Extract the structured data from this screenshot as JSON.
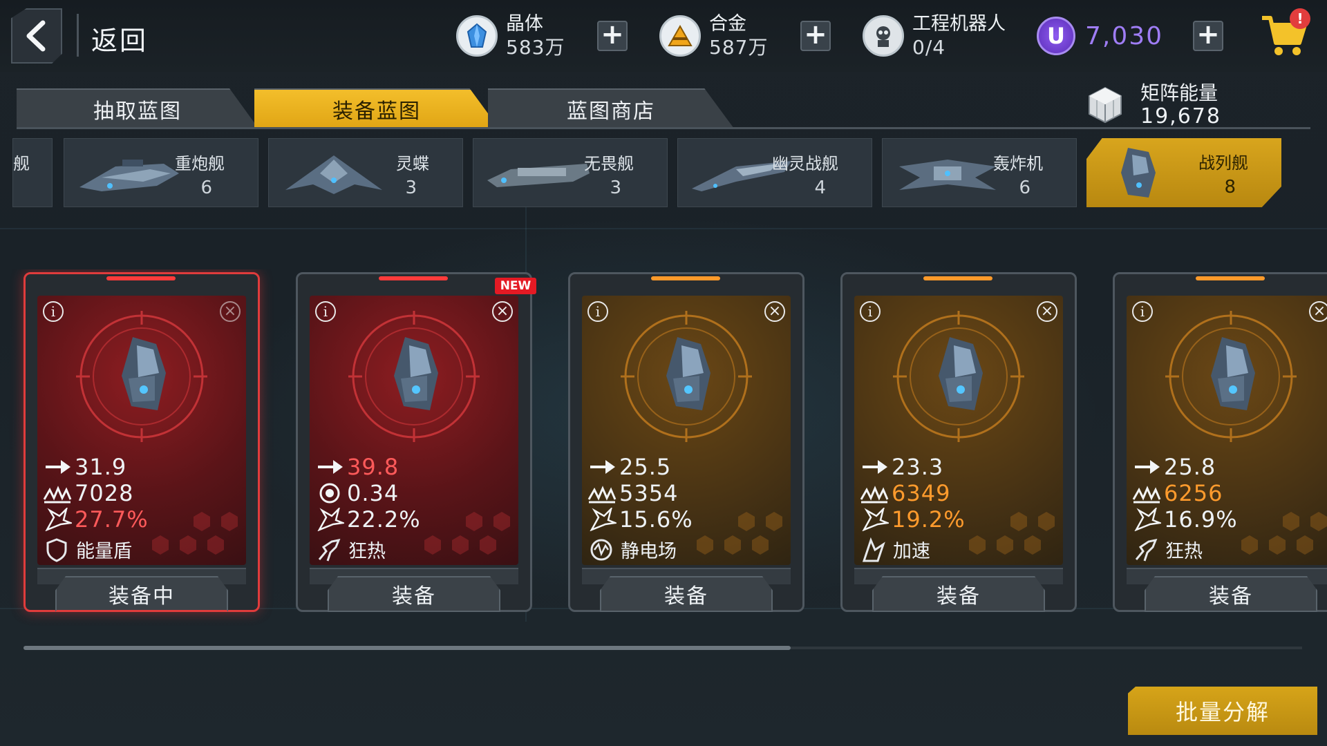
{
  "header": {
    "back_label": "返回",
    "resources": [
      {
        "name": "晶体",
        "value": "583万",
        "icon": "crystal-icon"
      },
      {
        "name": "合金",
        "value": "587万",
        "icon": "alloy-icon"
      },
      {
        "name": "工程机器人",
        "value": "0/4",
        "icon": "robot-icon"
      }
    ],
    "currency": {
      "symbol": "U",
      "value": "7,030",
      "color": "#9f7df5"
    },
    "cart_badge": "!"
  },
  "tabs": [
    {
      "label": "抽取蓝图",
      "active": false
    },
    {
      "label": "装备蓝图",
      "active": true
    },
    {
      "label": "蓝图商店",
      "active": false
    }
  ],
  "matrix_energy": {
    "label": "矩阵能量",
    "value": "19,678"
  },
  "ship_filters": [
    {
      "name": "舰",
      "count": "",
      "partial": true
    },
    {
      "name": "重炮舰",
      "count": "6"
    },
    {
      "name": "灵蝶",
      "count": "3"
    },
    {
      "name": "无畏舰",
      "count": "3"
    },
    {
      "name": "幽灵战舰",
      "count": "4"
    },
    {
      "name": "轰炸机",
      "count": "6"
    },
    {
      "name": "战列舰",
      "count": "8",
      "active": true
    }
  ],
  "cards": [
    {
      "theme": "red",
      "equipped": true,
      "new": false,
      "stats": [
        "31.9",
        "7028",
        "27.7%"
      ],
      "highlight": [
        null,
        null,
        "red"
      ],
      "stat2_icon": "armor-icon",
      "skill_icon": "shield-icon",
      "skill": "能量盾",
      "button": "装备中"
    },
    {
      "theme": "red",
      "equipped": false,
      "new": true,
      "stats": [
        "39.8",
        "0.34",
        "22.2%"
      ],
      "highlight": [
        "red",
        null,
        null
      ],
      "stat2_icon": "reload-icon",
      "skill_icon": "frenzy-icon",
      "skill": "狂热",
      "button": "装备"
    },
    {
      "theme": "gold",
      "equipped": false,
      "new": false,
      "stats": [
        "25.5",
        "5354",
        "15.6%"
      ],
      "highlight": [
        null,
        null,
        null
      ],
      "stat2_icon": "armor-icon",
      "skill_icon": "static-field-icon",
      "skill": "静电场",
      "button": "装备"
    },
    {
      "theme": "gold",
      "equipped": false,
      "new": false,
      "stats": [
        "23.3",
        "6349",
        "19.2%"
      ],
      "highlight": [
        null,
        "orange",
        "orange"
      ],
      "stat2_icon": "armor-icon",
      "skill_icon": "boost-icon",
      "skill": "加速",
      "button": "装备"
    },
    {
      "theme": "gold",
      "equipped": false,
      "new": false,
      "stats": [
        "25.8",
        "6256",
        "16.9%"
      ],
      "highlight": [
        null,
        "orange",
        null
      ],
      "stat2_icon": "armor-icon",
      "skill_icon": "frenzy-icon",
      "skill": "狂热",
      "button": "装备"
    }
  ],
  "new_badge": "NEW",
  "scroll_progress": 0.6,
  "bulk_button": "批量分解",
  "colors": {
    "accent": "#e0a514",
    "equipped_border": "#e03c3c",
    "stat_red": "#ff5a5a",
    "stat_orange": "#ff9b2d"
  }
}
